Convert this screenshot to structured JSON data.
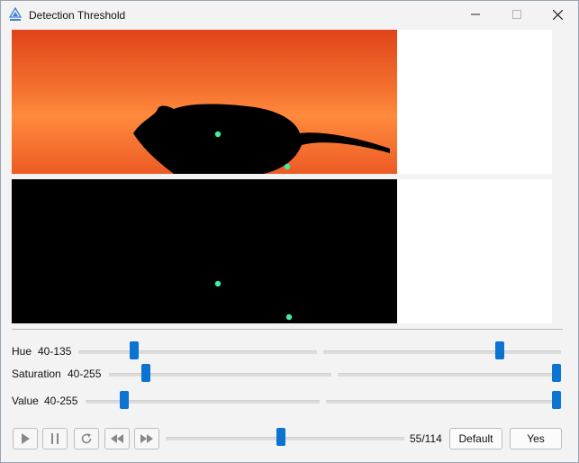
{
  "window": {
    "title": "Detection Threshold",
    "app_icon": "app-logo-icon"
  },
  "sliders": [
    {
      "label": "Hue",
      "range": "40-135"
    },
    {
      "label": "Saturation",
      "range": "40-255"
    },
    {
      "label": "Value",
      "range": "40-255"
    }
  ],
  "playback": {
    "controls": [
      "play-icon",
      "pause-icon",
      "refresh-icon",
      "rewind-icon",
      "fast-forward-icon"
    ],
    "frame_counter": "55/114",
    "frame_current": 55,
    "frame_total": 114
  },
  "buttons": {
    "default_label": "Default",
    "yes_label": "Yes"
  },
  "colors": {
    "accent": "#0b73d2",
    "video_background": "#f06a2c",
    "mask_background": "#000000",
    "marker": "#3cf0a0"
  }
}
